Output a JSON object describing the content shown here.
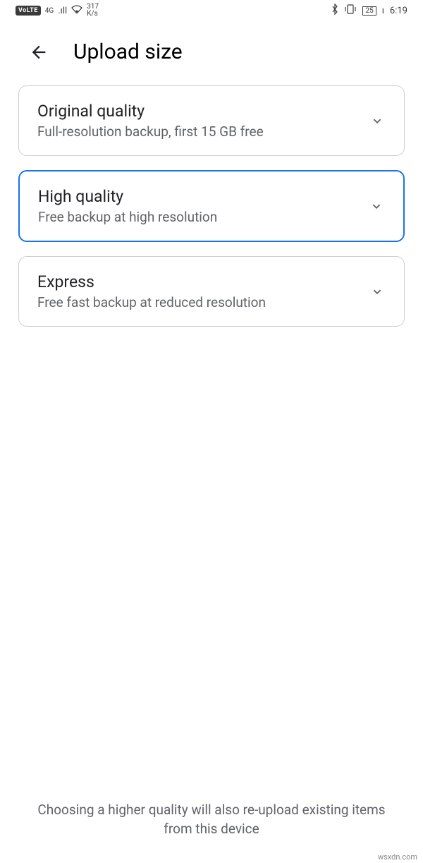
{
  "status": {
    "volte": "VoLTE",
    "net": "4G",
    "signal_glyph": ".ıll",
    "wifi_glyph": "⇊",
    "speed_num": "317",
    "speed_unit": "K/s",
    "bluetooth": "✻",
    "vibrate": "▯",
    "battery": "25",
    "time": "6:19"
  },
  "header": {
    "title": "Upload size"
  },
  "options": [
    {
      "title": "Original quality",
      "desc": "Full-resolution backup, first 15 GB free",
      "selected": false
    },
    {
      "title": "High quality",
      "desc": "Free backup at high resolution",
      "selected": true
    },
    {
      "title": "Express",
      "desc": "Free fast backup at reduced resolution",
      "selected": false
    }
  ],
  "footer": "Choosing a higher quality will also re-upload existing items from this device",
  "watermark": "wsxdn.com"
}
